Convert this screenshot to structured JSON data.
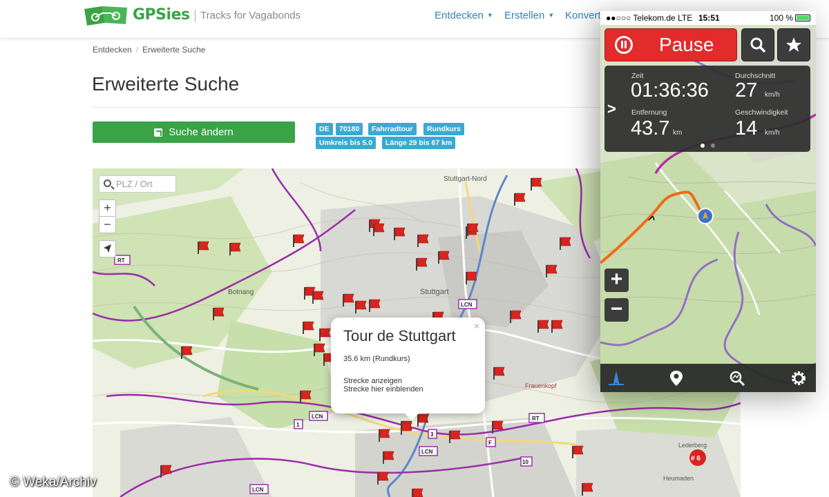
{
  "header": {
    "brand": "GPSies",
    "tagline": "Tracks for Vagabonds",
    "nav": [
      {
        "label": "Entdecken",
        "has_caret": true
      },
      {
        "label": "Erstellen",
        "has_caret": true
      },
      {
        "label": "Konvert",
        "has_caret": false
      }
    ]
  },
  "breadcrumb": [
    "Entdecken",
    "Erweiterte Suche"
  ],
  "page_title": "Erweiterte Suche",
  "edit_button": {
    "label": "Suche ändern",
    "icon": "edit-icon"
  },
  "filters": [
    "DE",
    "70180",
    "Fahrradtour",
    "Rundkurs",
    "Umkreis bis 5.0",
    "Länge 29 bis 67 km"
  ],
  "map": {
    "search_placeholder": "PLZ / Ort",
    "zoom_in": "+",
    "zoom_out": "−",
    "place_labels": [
      "Stuttgart-Nord",
      "Botnang",
      "Stuttgart",
      "Frauenkopf",
      "Heumaden",
      "Lederberg"
    ],
    "badges": [
      "RT",
      "LCN",
      "1",
      "3",
      "F",
      "10"
    ],
    "cluster": "# 6",
    "popup": {
      "title": "Tour de Stuttgart",
      "meta": "35.6 km (Rundkurs)",
      "link_show": "Strecke anzeigen",
      "link_overlay": "Strecke hier einblenden",
      "close": "×"
    },
    "watermark": "© Weka/Archiv"
  },
  "phone": {
    "status": {
      "carrier": "●●○○○ Telekom.de",
      "network": "LTE",
      "time": "15:51",
      "battery": "100 %"
    },
    "pause_label": "Pause",
    "stats": {
      "zeit_label": "Zeit",
      "zeit_value": "01:36:36",
      "durchschnitt_label": "Durchschnitt",
      "durchschnitt_value": "27",
      "durchschnitt_unit": "km/h",
      "entfernung_label": "Entfernung",
      "entfernung_value": "43.7",
      "entfernung_unit": "km",
      "geschwindigkeit_label": "Geschwindigkeit",
      "geschwindigkeit_value": "14",
      "geschwindigkeit_unit": "km/h"
    },
    "zoom_in": "+",
    "zoom_out": "−",
    "toolbar": [
      "compass-icon",
      "location-pin-icon",
      "search-route-icon",
      "settings-icon"
    ]
  },
  "colors": {
    "brand_green": "#3aa346",
    "nav_blue": "#2f86b8",
    "tag_blue": "#39a9d4",
    "pause_red": "#e22b2b",
    "route_purple": "#9b2fa8",
    "flag_red": "#d9241f"
  }
}
